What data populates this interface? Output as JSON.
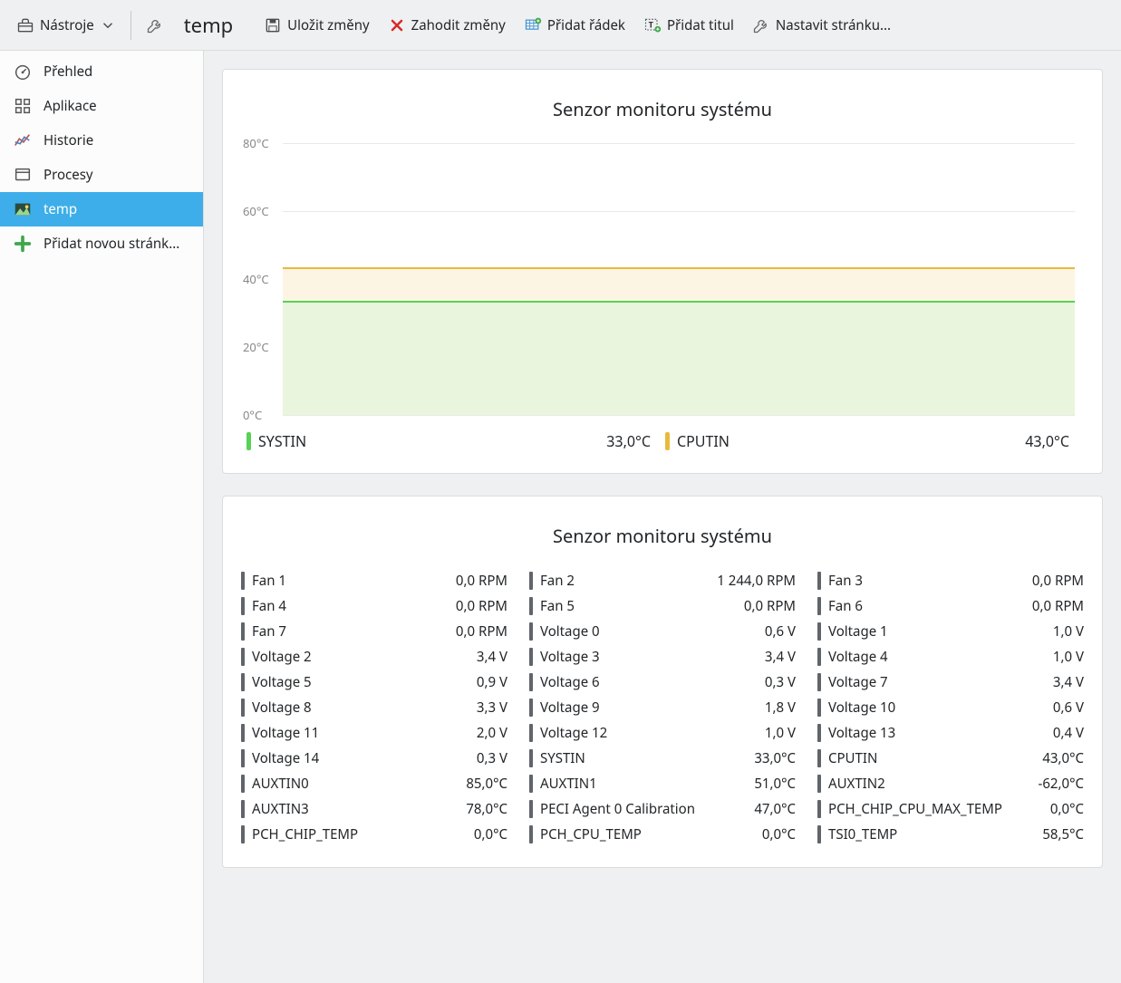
{
  "toolbar": {
    "tools_label": "Nástroje",
    "page_title": "temp",
    "save_label": "Uložit změny",
    "discard_label": "Zahodit změny",
    "add_row_label": "Přidat řádek",
    "add_title_label": "Přidat titul",
    "configure_label": "Nastavit stránku..."
  },
  "sidebar": {
    "items": [
      {
        "label": "Přehled"
      },
      {
        "label": "Aplikace"
      },
      {
        "label": "Historie"
      },
      {
        "label": "Procesy"
      },
      {
        "label": "temp"
      },
      {
        "label": "Přidat novou stránk..."
      }
    ]
  },
  "chart_data": {
    "type": "area",
    "title": "Senzor monitoru systému",
    "ylabel": "°C",
    "ylim": [
      0,
      80
    ],
    "yticks": [
      "0°C",
      "20°C",
      "40°C",
      "60°C",
      "80°C"
    ],
    "series": [
      {
        "name": "SYSTIN",
        "value": 33.0,
        "display": "33,0°C",
        "color": "#58d158",
        "fill": "#eaf5dd"
      },
      {
        "name": "CPUTIN",
        "value": 43.0,
        "display": "43,0°C",
        "color": "#e9b93e",
        "fill": "#fcf5e3"
      }
    ]
  },
  "sensor_panel": {
    "title": "Senzor monitoru systému",
    "items": [
      {
        "label": "Fan 1",
        "value": "0,0 RPM"
      },
      {
        "label": "Fan 2",
        "value": "1 244,0 RPM"
      },
      {
        "label": "Fan 3",
        "value": "0,0 RPM"
      },
      {
        "label": "Fan 4",
        "value": "0,0 RPM"
      },
      {
        "label": "Fan 5",
        "value": "0,0 RPM"
      },
      {
        "label": "Fan 6",
        "value": "0,0 RPM"
      },
      {
        "label": "Fan 7",
        "value": "0,0 RPM"
      },
      {
        "label": "Voltage 0",
        "value": "0,6 V"
      },
      {
        "label": "Voltage 1",
        "value": "1,0 V"
      },
      {
        "label": "Voltage 2",
        "value": "3,4 V"
      },
      {
        "label": "Voltage 3",
        "value": "3,4 V"
      },
      {
        "label": "Voltage 4",
        "value": "1,0 V"
      },
      {
        "label": "Voltage 5",
        "value": "0,9 V"
      },
      {
        "label": "Voltage 6",
        "value": "0,3 V"
      },
      {
        "label": "Voltage 7",
        "value": "3,4 V"
      },
      {
        "label": "Voltage 8",
        "value": "3,3 V"
      },
      {
        "label": "Voltage 9",
        "value": "1,8 V"
      },
      {
        "label": "Voltage 10",
        "value": "0,6 V"
      },
      {
        "label": "Voltage 11",
        "value": "2,0 V"
      },
      {
        "label": "Voltage 12",
        "value": "1,0 V"
      },
      {
        "label": "Voltage 13",
        "value": "0,4 V"
      },
      {
        "label": "Voltage 14",
        "value": "0,3 V"
      },
      {
        "label": "SYSTIN",
        "value": "33,0°C"
      },
      {
        "label": "CPUTIN",
        "value": "43,0°C"
      },
      {
        "label": "AUXTIN0",
        "value": "85,0°C"
      },
      {
        "label": "AUXTIN1",
        "value": "51,0°C"
      },
      {
        "label": "AUXTIN2",
        "value": "-62,0°C"
      },
      {
        "label": "AUXTIN3",
        "value": "78,0°C"
      },
      {
        "label": "PECI Agent 0 Calibration",
        "value": "47,0°C"
      },
      {
        "label": "PCH_CHIP_CPU_MAX_TEMP",
        "value": "0,0°C"
      },
      {
        "label": "PCH_CHIP_TEMP",
        "value": "0,0°C"
      },
      {
        "label": "PCH_CPU_TEMP",
        "value": "0,0°C"
      },
      {
        "label": "TSI0_TEMP",
        "value": "58,5°C"
      }
    ]
  }
}
